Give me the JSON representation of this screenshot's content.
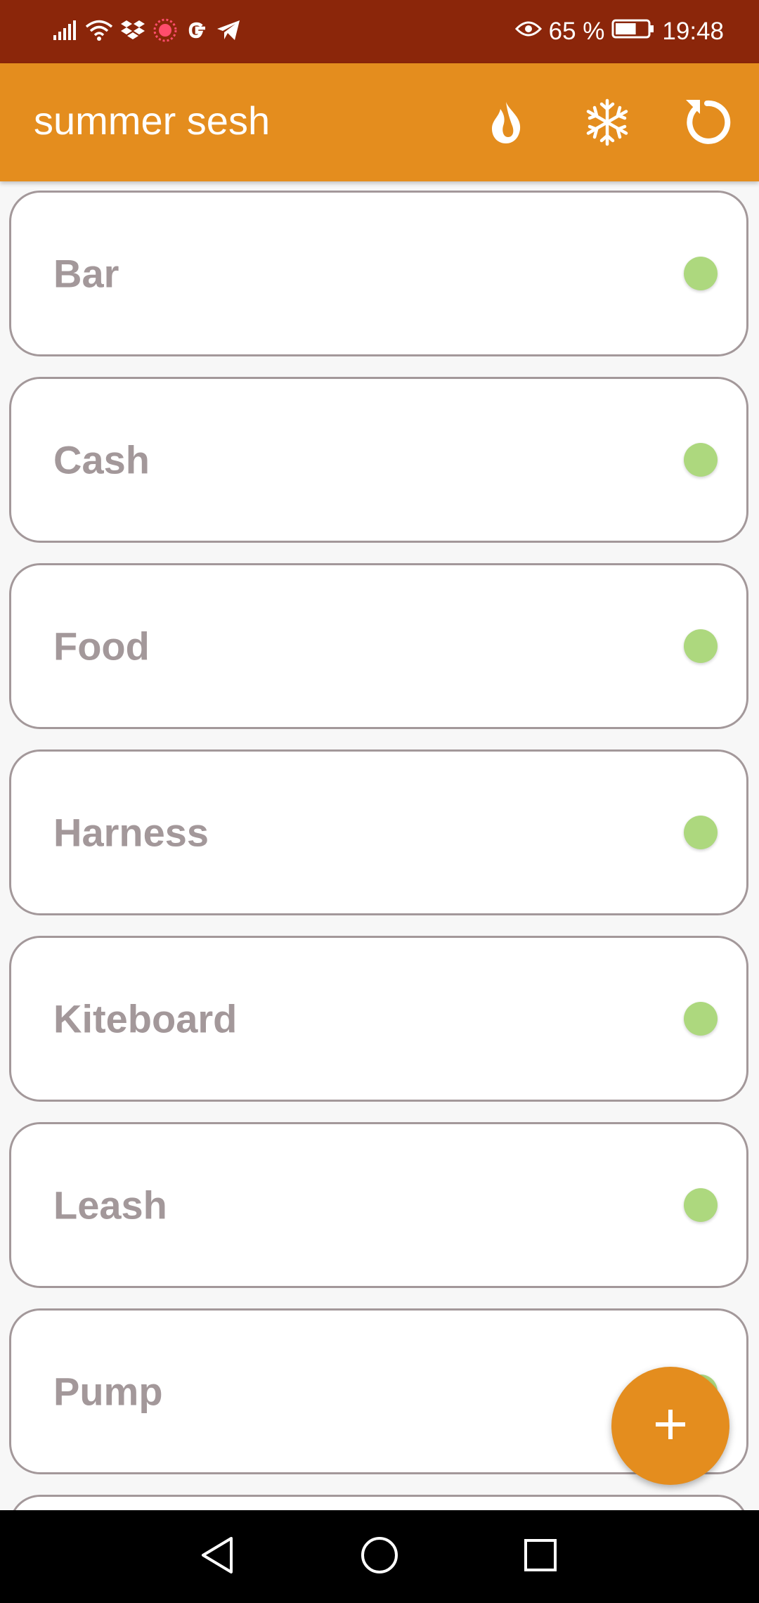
{
  "status_bar": {
    "battery_percent": "65 %",
    "battery_level": 0.65,
    "time": "19:48",
    "left_icons": [
      "signal-icon",
      "wifi-icon",
      "dropbox-icon",
      "recording-icon",
      "google-icon",
      "telegram-icon"
    ],
    "right_icons": [
      "eye-comfort-icon",
      "battery-icon"
    ]
  },
  "app_bar": {
    "title": "summer sesh",
    "actions": [
      "flame-icon",
      "snowflake-icon",
      "refresh-icon"
    ]
  },
  "items": [
    {
      "label": "Bar",
      "status": "green"
    },
    {
      "label": "Cash",
      "status": "green"
    },
    {
      "label": "Food",
      "status": "green"
    },
    {
      "label": "Harness",
      "status": "green"
    },
    {
      "label": "Kiteboard",
      "status": "green"
    },
    {
      "label": "Leash",
      "status": "green"
    },
    {
      "label": "Pump",
      "status": "green"
    },
    {
      "label": "",
      "status": "green"
    }
  ],
  "fab": {
    "icon": "plus-icon"
  },
  "nav_bar": {
    "buttons": [
      "back-icon",
      "home-icon",
      "recents-icon"
    ]
  },
  "colors": {
    "status_bar": "#8b260a",
    "app_bar": "#e48d1e",
    "card_border": "#a3989a",
    "card_text": "#a3989a",
    "status_dot": "#add87e",
    "fab": "#e48d1e",
    "background": "#f7f7f7"
  }
}
